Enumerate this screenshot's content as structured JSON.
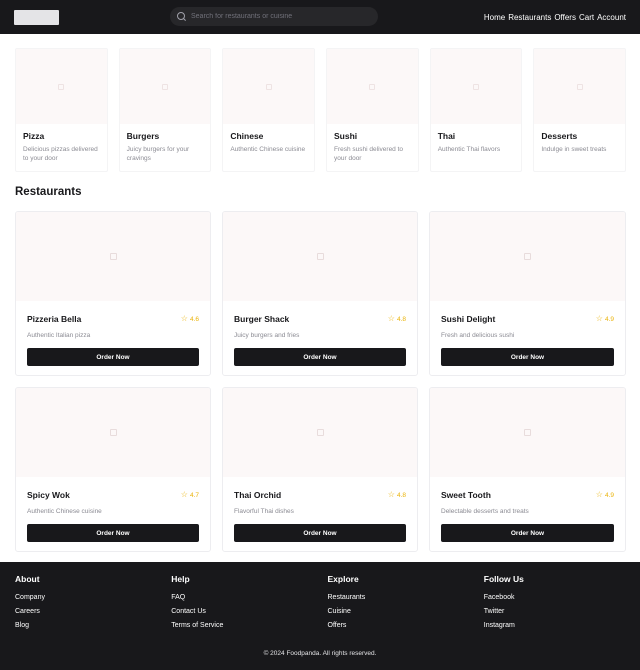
{
  "header": {
    "search_placeholder": "Search for restaurants or cuisine",
    "nav": [
      "Home",
      "Restaurants",
      "Offers",
      "Cart",
      "Account"
    ]
  },
  "categories": [
    {
      "title": "Pizza",
      "desc": "Delicious pizzas delivered to your door"
    },
    {
      "title": "Burgers",
      "desc": "Juicy burgers for your cravings"
    },
    {
      "title": "Chinese",
      "desc": "Authentic Chinese cuisine"
    },
    {
      "title": "Sushi",
      "desc": "Fresh sushi delivered to your door"
    },
    {
      "title": "Thai",
      "desc": "Authentic Thai flavors"
    },
    {
      "title": "Desserts",
      "desc": "Indulge in sweet treats"
    }
  ],
  "restaurants_section": {
    "title": "Restaurants",
    "order_label": "Order Now"
  },
  "restaurants": [
    {
      "name": "Pizzeria Bella",
      "rating": "4.6",
      "desc": "Authentic Italian pizza"
    },
    {
      "name": "Burger Shack",
      "rating": "4.8",
      "desc": "Juicy burgers and fries"
    },
    {
      "name": "Sushi Delight",
      "rating": "4.9",
      "desc": "Fresh and delicious sushi"
    },
    {
      "name": "Spicy Wok",
      "rating": "4.7",
      "desc": "Authentic Chinese cuisine"
    },
    {
      "name": "Thai Orchid",
      "rating": "4.8",
      "desc": "Flavorful Thai dishes"
    },
    {
      "name": "Sweet Tooth",
      "rating": "4.9",
      "desc": "Delectable desserts and treats"
    }
  ],
  "footer": {
    "columns": [
      {
        "title": "About",
        "links": [
          "Company",
          "Careers",
          "Blog"
        ]
      },
      {
        "title": "Help",
        "links": [
          "FAQ",
          "Contact Us",
          "Terms of Service"
        ]
      },
      {
        "title": "Explore",
        "links": [
          "Restaurants",
          "Cuisine",
          "Offers"
        ]
      },
      {
        "title": "Follow Us",
        "links": [
          "Facebook",
          "Twitter",
          "Instagram"
        ]
      }
    ],
    "copyright": "© 2024 Foodpanda. All rights reserved."
  },
  "colors": {
    "dark": "#18181b",
    "star": "#eab308",
    "placeholder_bg": "#fcf8f8"
  },
  "icons": {
    "rating": "star-icon",
    "search": "search-icon",
    "image": "image-placeholder-icon"
  }
}
